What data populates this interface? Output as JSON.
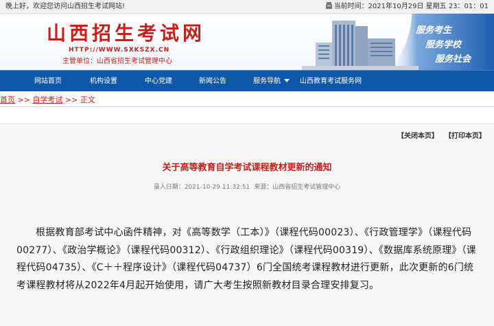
{
  "topbar": {
    "greeting": "晚上好，欢迎您访问山西招生考试网站!",
    "datetime": "当前时间：2021年10月29日 星期五 23：01：01"
  },
  "banner": {
    "title": "山西招生考试网",
    "url": "HTTP://WWW.SXKSZX.CN",
    "sponsor": "主管单位：山西省招生考试管理中心",
    "slogans": [
      "服务考生",
      "服务学校",
      "服务社会"
    ]
  },
  "nav": {
    "items": [
      {
        "label": "网站首页"
      },
      {
        "label": "机构设置"
      },
      {
        "label": "中心党建"
      },
      {
        "label": "新闻公告"
      },
      {
        "label": "服务导航"
      },
      {
        "label": "山西教育考试服务网"
      }
    ]
  },
  "breadcrumb": {
    "home": "首页",
    "sep1": " >> ",
    "section": "自学考试",
    "sep2": " >> ",
    "current": "正文"
  },
  "article": {
    "close_label": "【关闭本页】",
    "print_label": "【打印本页】",
    "title": "关于高等教育自学考试课程教材更新的通知",
    "date": "录入日期：2021-10-29 11:32:51",
    "source": "来源：山西省招生考试管理中心",
    "body": "根据教育部考试中心函件精神，对《高等数学（工本）》（课程代码00023）、《行政管理学》（课程代码00277）、《政治学概论》（课程代码00312）、《行政组织理论》（课程代码00319）、《数据库系统原理》（课程代码04735）、《C＋＋程序设计》（课程代码04737）6门全国统考课程教材进行更新，此次更新的6门统考课程教材将从2022年4月起开始使用，请广大考生按照新教材目录合理安排复习。"
  },
  "colors": {
    "brand_red": "#c4211a",
    "nav_blue": "#0f57a8"
  }
}
